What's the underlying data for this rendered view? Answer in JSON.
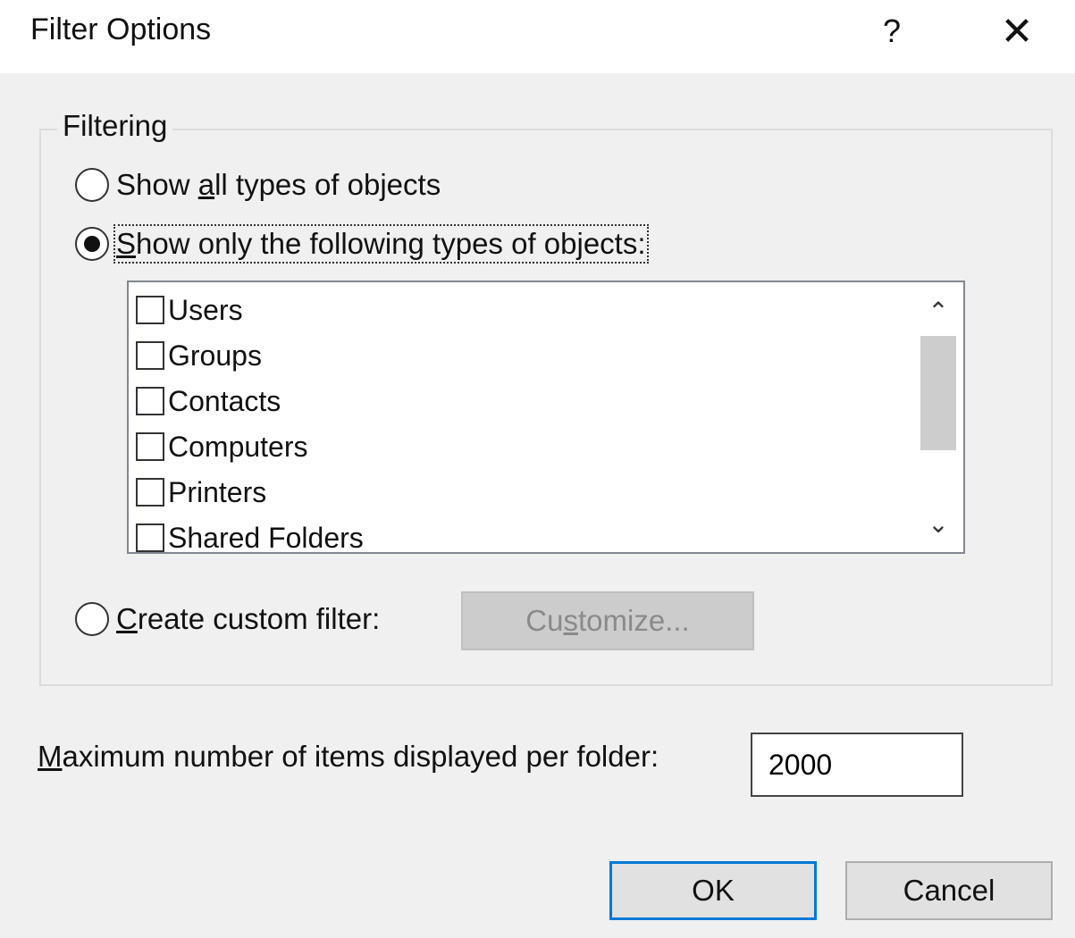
{
  "window": {
    "title": "Filter Options",
    "help_label": "?",
    "close_label": "✕"
  },
  "filtering": {
    "legend": "Filtering",
    "option_all": {
      "prefix": "Show ",
      "accel": "a",
      "suffix": "ll types of objects",
      "checked": false
    },
    "option_following": {
      "prefix": "",
      "accel": "S",
      "suffix": "how only the following types of objects:",
      "checked": true
    },
    "object_types": [
      {
        "label": "Users",
        "checked": false
      },
      {
        "label": "Groups",
        "checked": false
      },
      {
        "label": "Contacts",
        "checked": false
      },
      {
        "label": "Computers",
        "checked": false
      },
      {
        "label": "Printers",
        "checked": false
      },
      {
        "label": "Shared Folders",
        "checked": false
      }
    ],
    "scroll_up": "⌃",
    "scroll_down": "⌄",
    "option_custom": {
      "prefix": "",
      "accel": "C",
      "suffix": "reate custom filter:",
      "checked": false
    },
    "customize_button": {
      "prefix": "Cu",
      "accel": "s",
      "suffix": "tomize..."
    }
  },
  "max_items": {
    "label_accel": "M",
    "label_rest": "aximum number of items displayed per folder:",
    "value": "2000"
  },
  "buttons": {
    "ok": "OK",
    "cancel": "Cancel"
  }
}
